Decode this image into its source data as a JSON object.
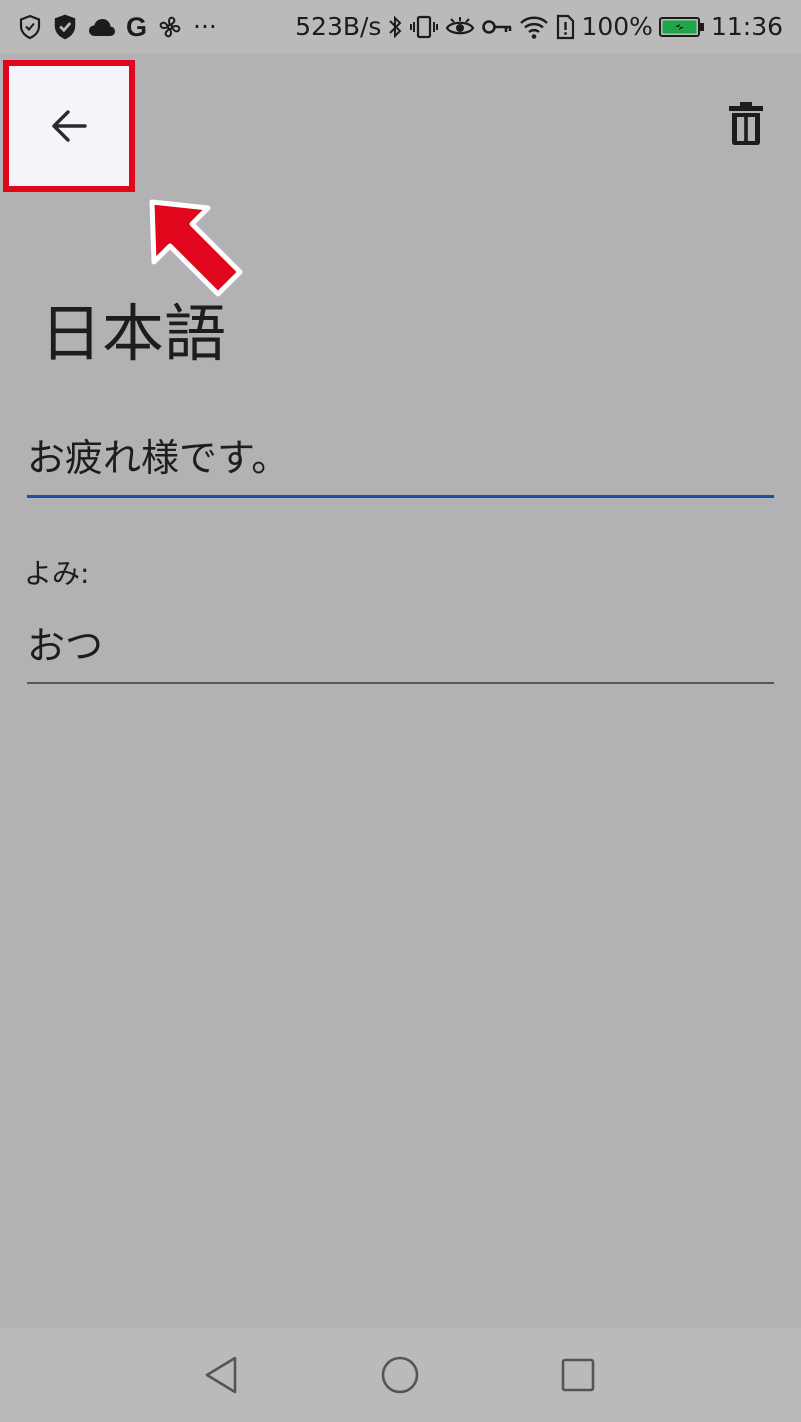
{
  "status_bar": {
    "network_speed": "523B/s",
    "google_letter": "G",
    "more_indicator": "···",
    "battery_percent": "100%",
    "time": "11:36",
    "icons": [
      "shield-outline-icon",
      "shield-check-icon",
      "cloud-icon",
      "google-icon",
      "fan-icon",
      "more-icon",
      "bluetooth-icon",
      "vibrate-icon",
      "eye-icon",
      "key-icon",
      "wifi-icon",
      "sim-alert-icon",
      "battery-charging-icon"
    ],
    "battery_color": "#1fa64a"
  },
  "toolbar": {
    "back_icon": "arrow-left-icon",
    "delete_icon": "trash-icon",
    "highlight_color": "#e0061c"
  },
  "content": {
    "language_title": "日本語",
    "phrase": "お疲れ様です。",
    "reading_label": "よみ:",
    "reading": "おつ"
  },
  "nav_bar": {
    "icons": [
      "nav-back-icon",
      "nav-home-icon",
      "nav-recents-icon"
    ]
  },
  "colors": {
    "background": "#b2b2b4",
    "accent_underline": "#1f4ea8",
    "annotation_red": "#e0061c"
  }
}
